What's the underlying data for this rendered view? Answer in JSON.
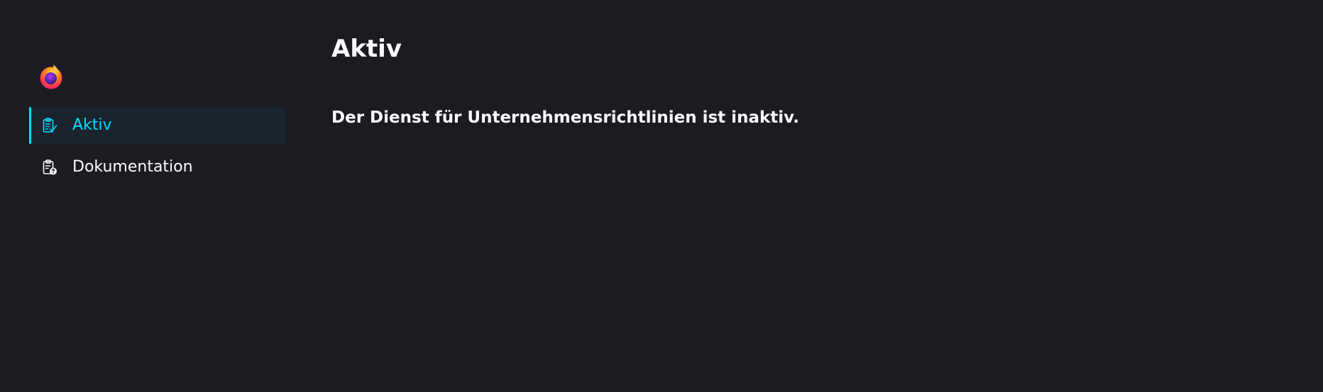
{
  "sidebar": {
    "logo": "firefox-logo-icon",
    "items": [
      {
        "label": "Aktiv",
        "icon": "clipboard-check-icon",
        "selected": true
      },
      {
        "label": "Dokumentation",
        "icon": "clipboard-help-icon",
        "selected": false
      }
    ]
  },
  "main": {
    "title": "Aktiv",
    "status": "Der Dienst für Unternehmensrichtlinien ist inaktiv."
  },
  "colors": {
    "background": "#1c1b22",
    "accent": "#00ddff",
    "selected_background": "#1a242e",
    "text": "#fbfbfe"
  }
}
